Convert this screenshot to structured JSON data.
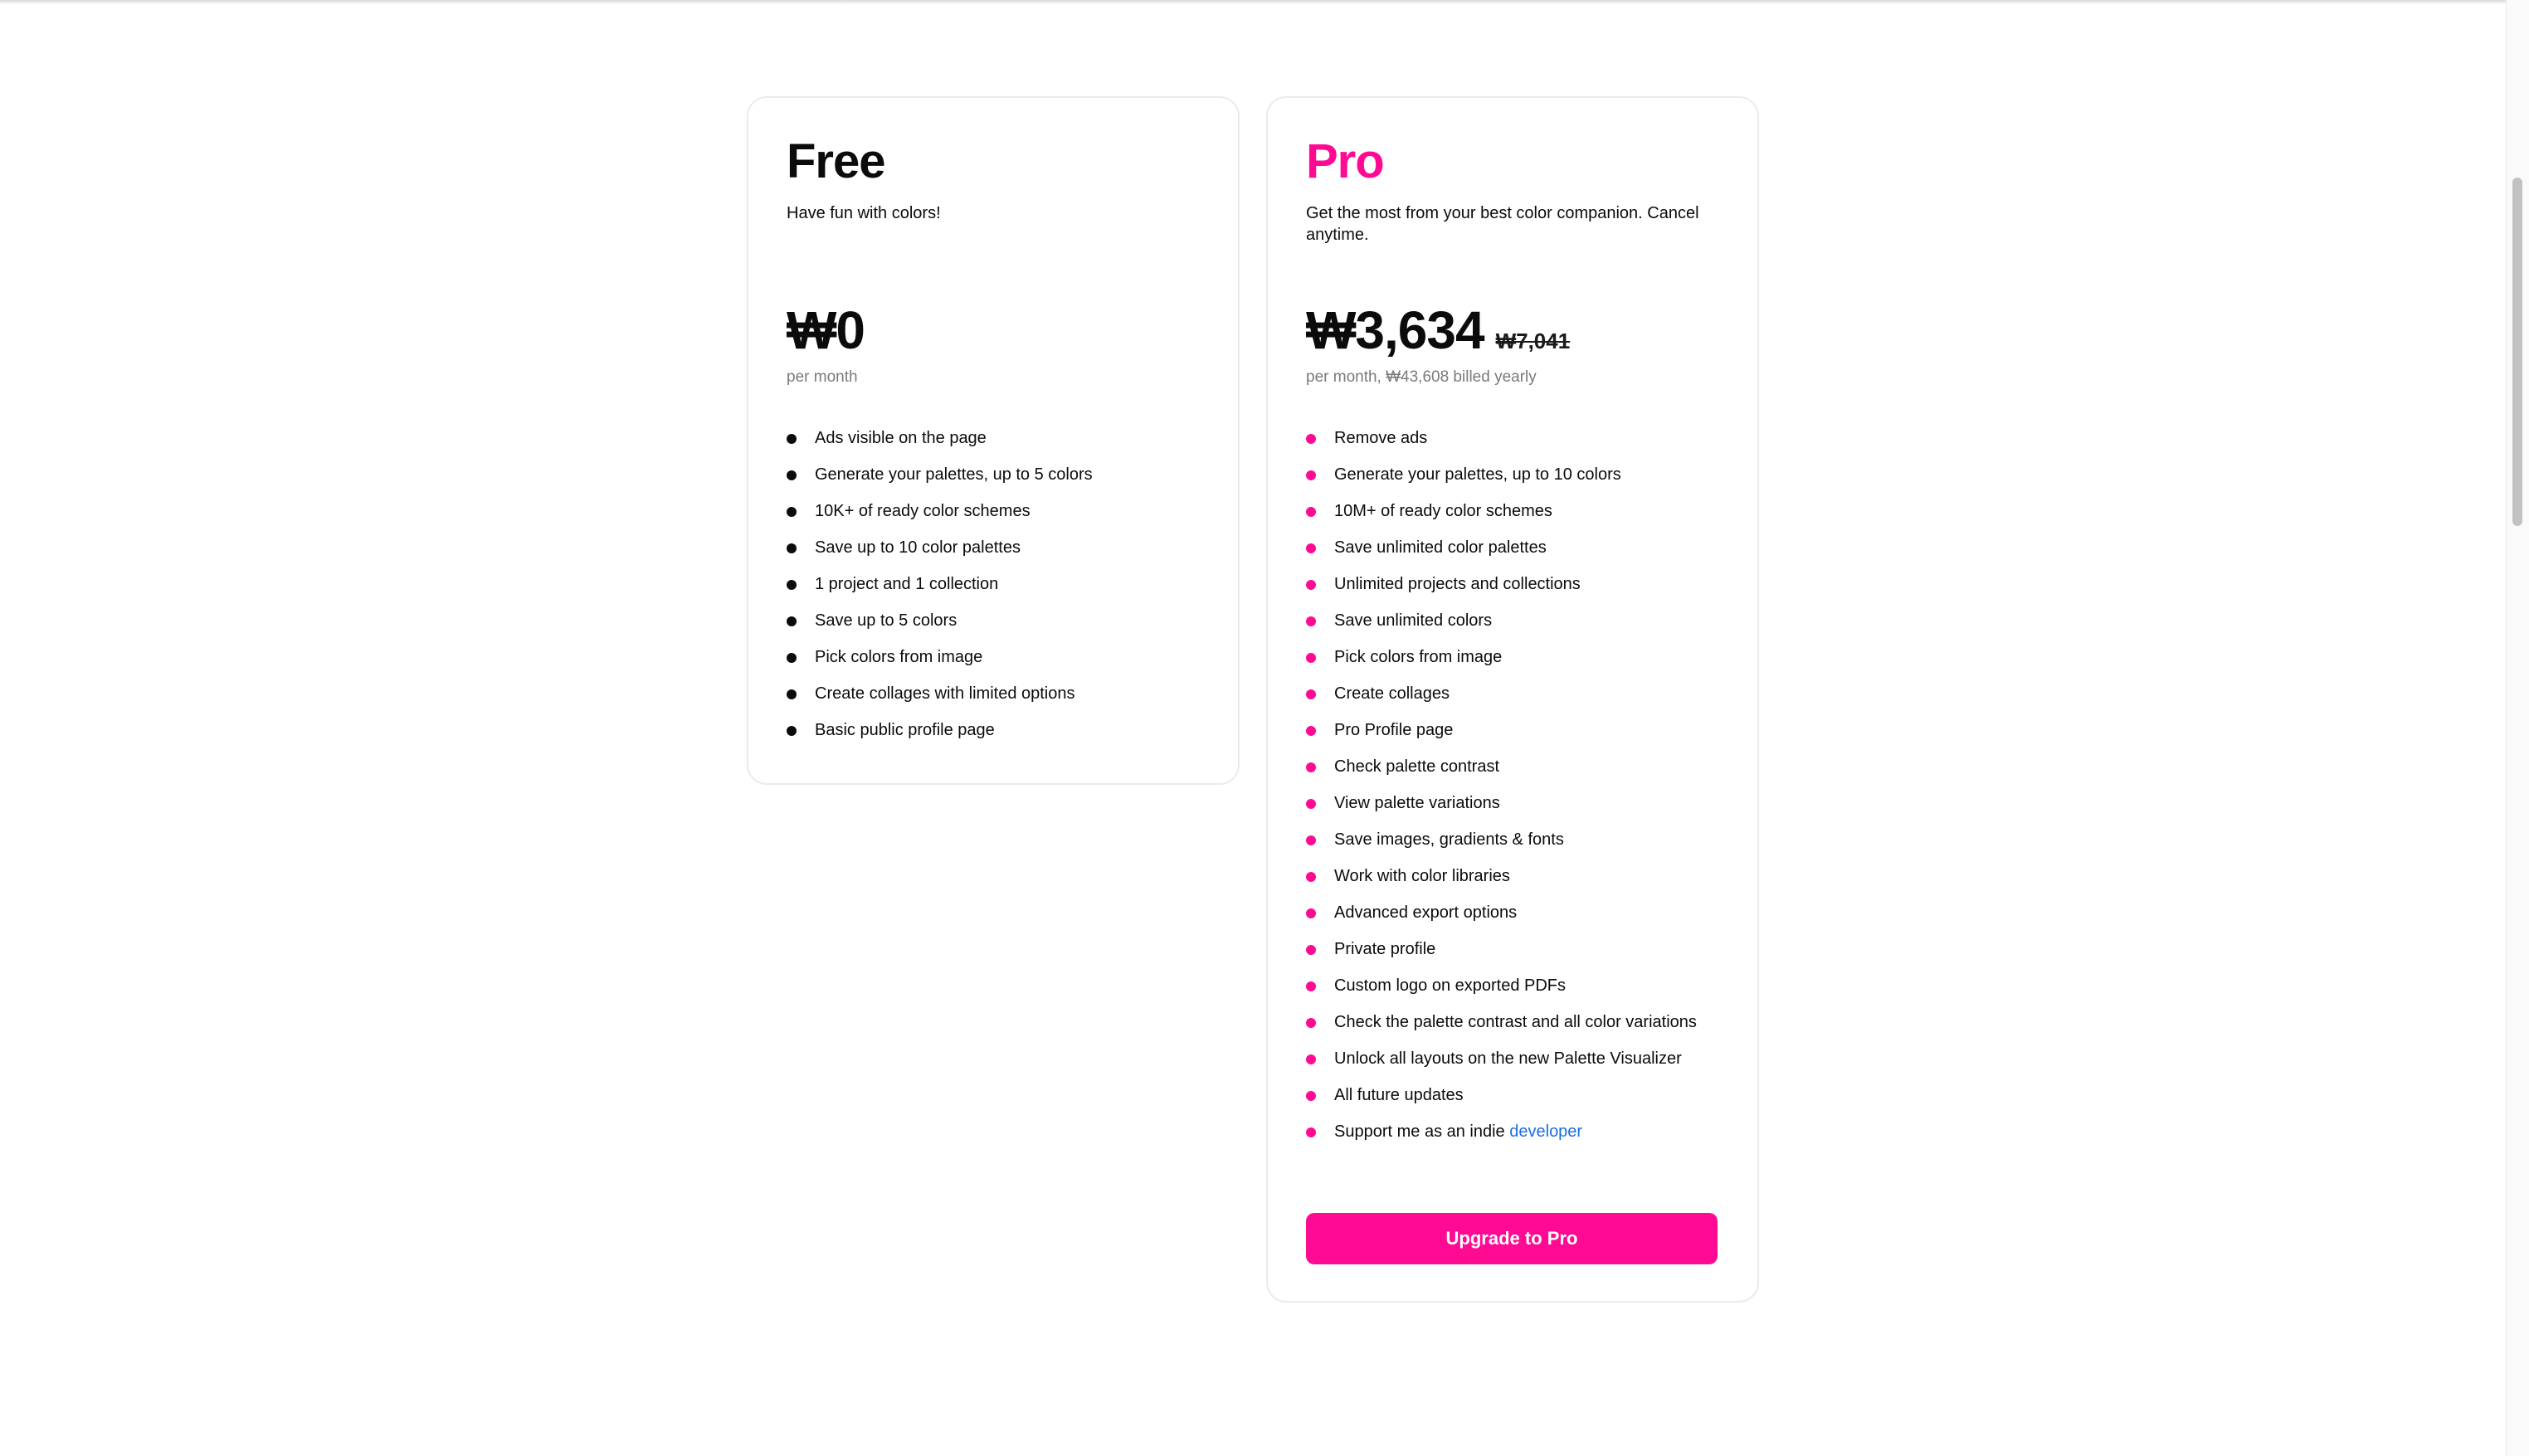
{
  "colors": {
    "accent": "#ff0a93",
    "text": "#0b0b0b",
    "muted": "#7a7a7a",
    "link": "#1a6ee8",
    "border": "#ebebeb"
  },
  "plans": {
    "free": {
      "name": "Free",
      "description": "Have fun with colors!",
      "price": "₩0",
      "period": "per month",
      "bullet_icon": "dot-icon",
      "features": [
        "Ads visible on the page",
        "Generate your palettes, up to 5 colors",
        "10K+ of ready color schemes",
        "Save up to 10 color palettes",
        "1 project and 1 collection",
        "Save up to 5 colors",
        "Pick colors from image",
        "Create collages with limited options",
        "Basic public profile page"
      ]
    },
    "pro": {
      "name": "Pro",
      "description": "Get the most from your best color companion. Cancel anytime.",
      "price": "₩3,634",
      "old_price": "₩7,041",
      "period": "per month, ₩43,608 billed yearly",
      "bullet_icon": "dot-icon",
      "features": [
        "Remove ads",
        "Generate your palettes, up to 10 colors",
        "10M+ of ready color schemes",
        "Save unlimited color palettes",
        "Unlimited projects and collections",
        "Save unlimited colors",
        "Pick colors from image",
        "Create collages",
        "Pro Profile page",
        "Check palette contrast",
        "View palette variations",
        "Save images, gradients & fonts",
        "Work with color libraries",
        "Advanced export options",
        "Private profile",
        "Custom logo on exported PDFs",
        "Check the palette contrast and all color variations",
        "Unlock all layouts on the new Palette Visualizer",
        "All future updates"
      ],
      "support_text": "Support me as an indie ",
      "support_link": "developer",
      "cta_label": "Upgrade to Pro"
    }
  }
}
